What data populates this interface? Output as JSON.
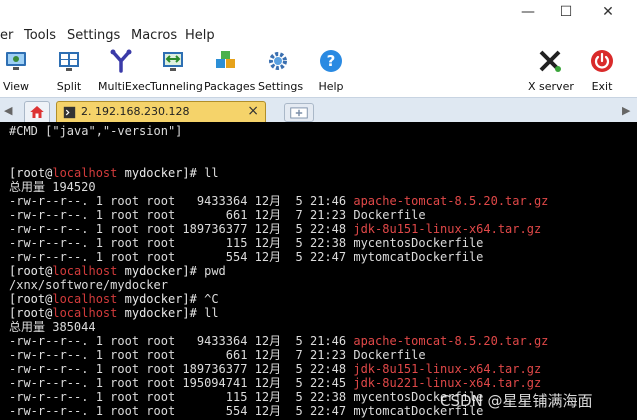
{
  "window": {
    "minimize_glyph": "—",
    "maximize_glyph": "☐",
    "close_glyph": "✕"
  },
  "menu": [
    "er",
    "Tools",
    "Settings",
    "Macros",
    "Help"
  ],
  "toolbar": {
    "view": "View",
    "split": "Split",
    "multiexec": "MultiExec",
    "tunneling": "Tunneling",
    "packages": "Packages",
    "settings": "Settings",
    "help": "Help",
    "xserver": "X server",
    "exit": "Exit"
  },
  "tabs": {
    "session_label": "2. 192.168.230.128",
    "close_glyph": "×"
  },
  "terminal": {
    "prompt_user": "[root@",
    "prompt_host": "localhost",
    "prompt_dir": " mydocker]# ",
    "lines": [
      {
        "type": "text",
        "text": "#CMD [\"java\",\"-version\"]"
      },
      {
        "type": "blank"
      },
      {
        "type": "blank"
      },
      {
        "type": "prompt",
        "cmd": "ll"
      },
      {
        "type": "text",
        "text": "总用量 194520"
      },
      {
        "type": "file",
        "meta": "-rw-r--r--. 1 root root   9433364 12月  5 21:46 ",
        "name": "apache-tomcat-8.5.20.tar.gz",
        "red": true
      },
      {
        "type": "file",
        "meta": "-rw-r--r--. 1 root root       661 12月  7 21:23 ",
        "name": "Dockerfile",
        "red": false
      },
      {
        "type": "file",
        "meta": "-rw-r--r--. 1 root root 189736377 12月  5 22:48 ",
        "name": "jdk-8u151-linux-x64.tar.gz",
        "red": true
      },
      {
        "type": "file",
        "meta": "-rw-r--r--. 1 root root       115 12月  5 22:38 ",
        "name": "mycentosDockerfile",
        "red": false
      },
      {
        "type": "file",
        "meta": "-rw-r--r--. 1 root root       554 12月  5 22:47 ",
        "name": "mytomcatDockerfile",
        "red": false
      },
      {
        "type": "prompt",
        "cmd": "pwd"
      },
      {
        "type": "text",
        "text": "/xnx/softwore/mydocker"
      },
      {
        "type": "prompt",
        "cmd": "^C"
      },
      {
        "type": "prompt",
        "cmd": "ll"
      },
      {
        "type": "text",
        "text": "总用量 385044"
      },
      {
        "type": "file",
        "meta": "-rw-r--r--. 1 root root   9433364 12月  5 21:46 ",
        "name": "apache-tomcat-8.5.20.tar.gz",
        "red": true
      },
      {
        "type": "file",
        "meta": "-rw-r--r--. 1 root root       661 12月  7 21:23 ",
        "name": "Dockerfile",
        "red": false
      },
      {
        "type": "file",
        "meta": "-rw-r--r--. 1 root root 189736377 12月  5 22:48 ",
        "name": "jdk-8u151-linux-x64.tar.gz",
        "red": true
      },
      {
        "type": "file",
        "meta": "-rw-r--r--. 1 root root 195094741 12月  5 22:45 ",
        "name": "jdk-8u221-linux-x64.tar.gz",
        "red": true
      },
      {
        "type": "file",
        "meta": "-rw-r--r--. 1 root root       115 12月  5 22:38 ",
        "name": "mycentosDockerfile",
        "red": false
      },
      {
        "type": "file",
        "meta": "-rw-r--r--. 1 root root       554 12月  5 22:47 ",
        "name": "mytomcatDockerfile",
        "red": false
      }
    ]
  },
  "watermark": "CSDN @星星铺满海面",
  "colors": {
    "terminal_bg": "#000000",
    "archive_red": "#e04848",
    "hostname_red": "#d23b3b",
    "session_tab": "#f5d36a"
  }
}
